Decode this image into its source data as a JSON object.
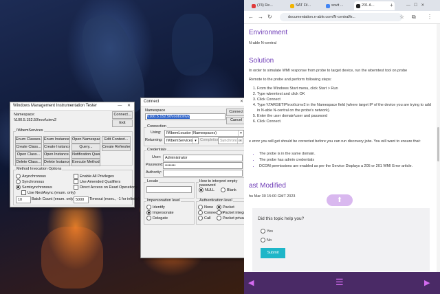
{
  "colors": {
    "accent": "#6d3ab6",
    "submit": "#1fb6c8",
    "bottom_bar": "#4a2a66",
    "link": "#2b6fbf"
  },
  "wmi_tester": {
    "title": "Windows Management Instrumentation Tester",
    "namespace_label": "Namespace:",
    "namespace_value": "\\\\100.5.152.50\\root\\cimv2",
    "connect_button": "Connect...",
    "exit_button": "Exit",
    "services_group": "IWbemServices",
    "buttons": [
      [
        "Enum Classes...",
        "Enum Instances...",
        "Open Namespace...",
        "Edit Context..."
      ],
      [
        "Create Class...",
        "Create Instance...",
        "Query...",
        "Create Refresher..."
      ],
      [
        "Open Class...",
        "Open Instance...",
        "Notification Query...",
        ""
      ],
      [
        "Delete Class...",
        "Delete Instance...",
        "Execute Method...",
        ""
      ]
    ],
    "method_group": "Method Invocation Options",
    "invocation": [
      "Asynchronous",
      "Synchronous",
      "Semisynchronous"
    ],
    "use_next_async": "Use NextAsync (enum. only)",
    "options": [
      "Enable All Privileges",
      "Use Amended Qualifiers",
      "Direct Access on Read Operations"
    ],
    "batch_value": "10",
    "batch_label": "Batch Count (enum. only)",
    "timeout_value": "5000",
    "timeout_label": "Timeout (msec., -1 for infinite)"
  },
  "connect_dialog": {
    "title": "Connect",
    "namespace_label": "Namespace",
    "namespace_value": "\\\\100.5.152.50\\root\\cimv2",
    "connect_button": "Connect",
    "cancel_button": "Cancel",
    "connection_group": "Connection",
    "using_label": "Using:",
    "using_value": "IWbemLocator (Namespaces)",
    "returning_label": "Returning:",
    "returning_value": "IWbemServices",
    "completion_label": "Completion:",
    "completion_value": "Synchronous",
    "credentials_group": "Credentials",
    "user_label": "User:",
    "user_value": "Administrator",
    "password_label": "Password:",
    "password_value": "••••••••",
    "authority_label": "Authority:",
    "authority_value": "",
    "locale_group": "Locale",
    "empty_pw_group": "How to interpret empty password",
    "empty_pw_options": [
      "NULL",
      "Blank"
    ],
    "impersonation_group": "Impersonation level",
    "impersonation_options": [
      "Identify",
      "Impersonate",
      "Delegate"
    ],
    "auth_group": "Authentication level",
    "auth_options": [
      "None",
      "Packet",
      "Connection",
      "Packet integrity",
      "Call",
      "Packet privacy"
    ]
  },
  "browser": {
    "tabs": [
      "(74) Re...",
      "SAT Fil...",
      "sovit ...",
      "201 A..."
    ],
    "url": "documentation.n-able.com/N-central/tr...",
    "env_heading": "Environment",
    "env_text": "N-able N-central",
    "sol_heading": "Solution",
    "sol_intro": "In order to simulate WMI response from probe to target device, run the wbemtest tool on probe",
    "remote_text": "Remote to the probe and perform following steps:",
    "steps": [
      "From the Windows Start menu, click Start > Run",
      "Type wbemtest and click OK",
      "Click Connect",
      "Type \\\\TARGETIP\\root\\cimv2 in the Namespace field (where target IP of the device you are trying to add in N-able N-central on the probe's network).",
      "Enter the user domain\\user and password",
      "Click Connect."
    ],
    "error_text": "e error you will get should be corrected before you can run discovery jobs. You will want to ensure that:",
    "bullets": [
      "The probe is in the same domain.",
      "The probe has admin credentials",
      "DCOM permissions are enabled as per the Service Displays a 205 or 201 WMI Error article."
    ],
    "modified_heading": "ast Modified",
    "modified_date": "hu Mar 30 15:00 GMT 2023",
    "feedback_question": "Did this topic help you?",
    "feedback_options": [
      "Yes",
      "No"
    ],
    "submit_label": "Submit"
  }
}
